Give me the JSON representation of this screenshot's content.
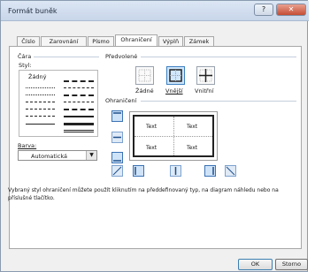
{
  "window": {
    "title": "Formát buněk"
  },
  "tabs": [
    {
      "label": "Číslo"
    },
    {
      "label": "Zarovnání"
    },
    {
      "label": "Písmo"
    },
    {
      "label": "Ohraničení"
    },
    {
      "label": "Výplň"
    },
    {
      "label": "Zámek"
    }
  ],
  "line_section": {
    "label": "Čára",
    "style_label": "Styl:",
    "none_label": "Žádný",
    "color_label": "Barva:",
    "color_value": "Automatická"
  },
  "presets": {
    "label": "Předvolené",
    "items": [
      {
        "label": "Žádné"
      },
      {
        "label": "Vnější"
      },
      {
        "label": "Vnitřní"
      }
    ],
    "selected": "Vnější"
  },
  "border_section": {
    "label": "Ohraničení"
  },
  "preview": {
    "cells": [
      "Text",
      "Text",
      "Text",
      "Text"
    ]
  },
  "hint": "Vybraný styl ohraničení můžete použít kliknutím na předdefinovaný typ, na diagram náhledu nebo na příslušné tlačítko.",
  "buttons": {
    "ok": "OK",
    "cancel": "Storno"
  },
  "colors": {
    "title_bar": "#c8d6ea",
    "close_button": "#c44d34",
    "accent": "#3c7fbf",
    "dialog_bg": "#f0f0f0"
  }
}
